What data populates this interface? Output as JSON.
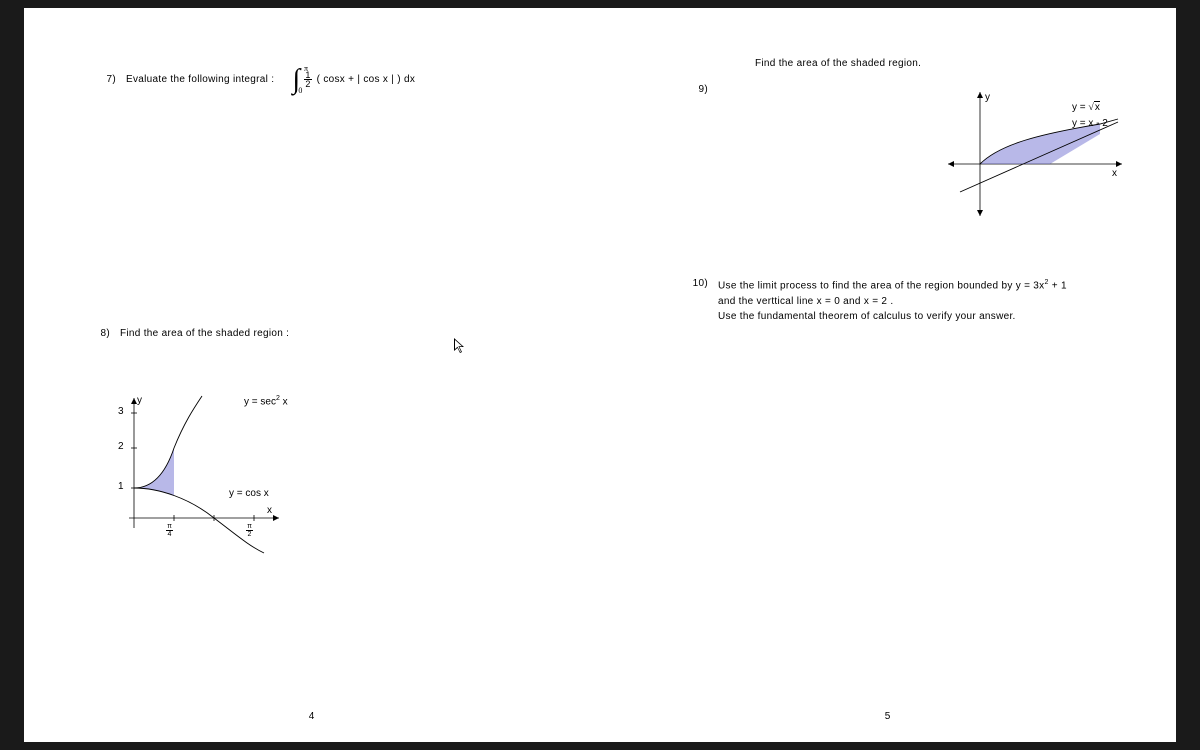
{
  "page_left": {
    "number": "4",
    "q7": {
      "num": "7)",
      "label": "Evaluate the following integral :",
      "int_lower": "0",
      "int_upper": "π",
      "frac_num": "1",
      "frac_den": "2",
      "body": "( cosx  +  | cos x |  )  dx"
    },
    "q8": {
      "num": "8)",
      "label": "Find the area of the shaded region :",
      "curve1": "y  =  sec",
      "curve1_exp": "2",
      "curve1_tail": " x",
      "curve2": "y  =  cos x",
      "y_ticks": [
        "3",
        "2",
        "1"
      ],
      "x_ticks_top": [
        "π",
        "π"
      ],
      "x_ticks_bot": [
        "4",
        "2"
      ],
      "axis_y": "y",
      "axis_x": "x"
    }
  },
  "page_right": {
    "number": "5",
    "q9": {
      "num": "9)",
      "header": "Find the area of the shaded region.",
      "curve1_pre": "y  =  ",
      "curve1_rad": "√",
      "curve1_body": "x",
      "curve2": "y  =  x - 2",
      "axis_y": "y",
      "axis_x": "x"
    },
    "q10": {
      "num": "10)",
      "line1a": "Use  the  limit  process  to  find  the  area  of  the  region  bounded  by   y = 3x",
      "line1exp": "2",
      "line1b": " + 1",
      "line2": "and  the  verttical  line  x = 0   and   x = 2 .",
      "line3": "Use  the  fundamental  theorem  of  calculus  to  verify  your  answer."
    }
  }
}
